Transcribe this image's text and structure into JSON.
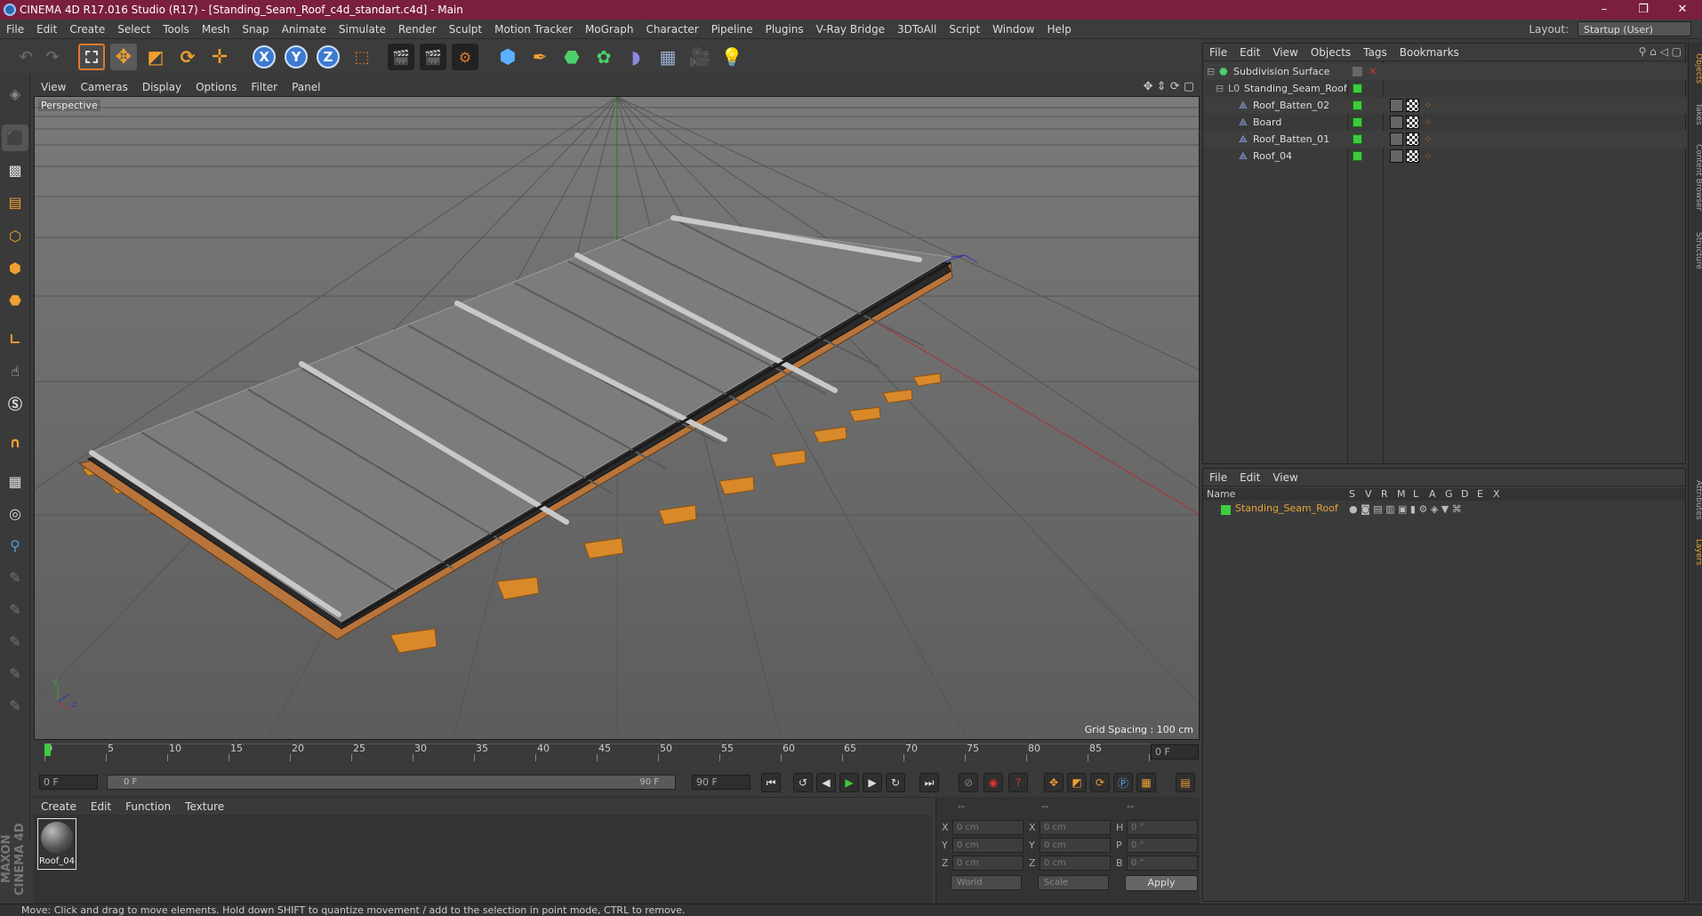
{
  "window": {
    "title": "CINEMA 4D R17.016 Studio (R17) - [Standing_Seam_Roof_c4d_standart.c4d] - Main",
    "controls": {
      "minimize": "–",
      "restore": "❐",
      "close": "✕"
    }
  },
  "menubar": {
    "items": [
      "File",
      "Edit",
      "Create",
      "Select",
      "Tools",
      "Mesh",
      "Snap",
      "Animate",
      "Simulate",
      "Render",
      "Sculpt",
      "Motion Tracker",
      "MoGraph",
      "Character",
      "Pipeline",
      "Plugins",
      "V-Ray Bridge",
      "3DToAll",
      "Script",
      "Window",
      "Help"
    ],
    "layout_label": "Layout:",
    "layout_value": "Startup (User)"
  },
  "toolbar": {
    "axis_x": "X",
    "axis_y": "Y",
    "axis_z": "Z"
  },
  "viewport": {
    "menu": [
      "View",
      "Cameras",
      "Display",
      "Options",
      "Filter",
      "Panel"
    ],
    "label": "Perspective",
    "grid_spacing": "Grid Spacing : 100 cm",
    "axis_y": "y",
    "axis_z": "z"
  },
  "timeline": {
    "ticks": [
      "0",
      "5",
      "10",
      "15",
      "20",
      "25",
      "30",
      "35",
      "40",
      "45",
      "50",
      "55",
      "60",
      "65",
      "70",
      "75",
      "80",
      "85",
      "90"
    ],
    "current_frame": "0 F",
    "start_field": "0 F",
    "range_start": "0 F",
    "range_end": "90 F",
    "end_field": "90 F"
  },
  "materials": {
    "menu": [
      "Create",
      "Edit",
      "Function",
      "Texture"
    ],
    "items": [
      {
        "name": "Roof_04"
      }
    ]
  },
  "coords": {
    "header": [
      "--",
      "--",
      "--"
    ],
    "rows": [
      {
        "l1": "X",
        "v1": "0 cm",
        "l2": "X",
        "v2": "0 cm",
        "l3": "H",
        "v3": "0 °"
      },
      {
        "l1": "Y",
        "v1": "0 cm",
        "l2": "Y",
        "v2": "0 cm",
        "l3": "P",
        "v3": "0 °"
      },
      {
        "l1": "Z",
        "v1": "0 cm",
        "l2": "Z",
        "v2": "0 cm",
        "l3": "B",
        "v3": "0 °"
      }
    ],
    "space": "World",
    "mode": "Scale",
    "apply": "Apply"
  },
  "objects": {
    "menu": [
      "File",
      "Edit",
      "View",
      "Objects",
      "Tags",
      "Bookmarks"
    ],
    "tree": [
      {
        "name": "Subdivision Surface",
        "depth": 0
      },
      {
        "name": "Standing_Seam_Roof",
        "depth": 1
      },
      {
        "name": "Roof_Batten_02",
        "depth": 2
      },
      {
        "name": "Board",
        "depth": 2
      },
      {
        "name": "Roof_Batten_01",
        "depth": 2
      },
      {
        "name": "Roof_04",
        "depth": 2
      }
    ]
  },
  "layers": {
    "menu": [
      "File",
      "Edit",
      "View"
    ],
    "columns": [
      "Name",
      "S",
      "V",
      "R",
      "M",
      "L",
      "A",
      "G",
      "D",
      "E",
      "X"
    ],
    "rows": [
      {
        "name": "Standing_Seam_Roof",
        "color": "#3dcc3d"
      }
    ]
  },
  "right_dock": {
    "tabs": [
      "Objects",
      "Takes",
      "Content Browser",
      "Structure",
      "Attributes",
      "Layers"
    ]
  },
  "statusbar": {
    "text": "Move: Click and drag to move elements. Hold down SHIFT to quantize movement / add to the selection in point mode, CTRL to remove."
  },
  "branding": {
    "logo": "MAXON CINEMA 4D"
  },
  "colors": {
    "title_bar": "#7a1f3e",
    "accent_orange": "#e8a33a",
    "selection_green": "#3dcc3d",
    "axis_active": "#3d7bd0"
  }
}
